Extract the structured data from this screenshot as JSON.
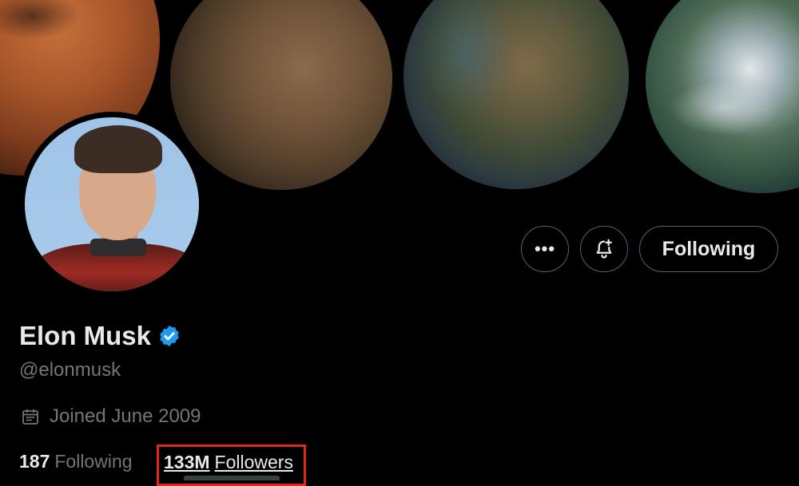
{
  "profile": {
    "name": "Elon Musk",
    "handle": "@elonmusk",
    "joined": "Joined June 2009",
    "verified_color": "#1d9bf0"
  },
  "actions": {
    "more_label": "•••",
    "following_label": "Following"
  },
  "stats": {
    "following_count": "187",
    "following_label": "Following",
    "followers_count": "133M",
    "followers_label": "Followers"
  },
  "icons": {
    "more": "more-icon",
    "notifications": "bell-plus-icon",
    "verified": "verified-badge-icon",
    "calendar": "calendar-icon"
  },
  "colors": {
    "background": "#000000",
    "text_primary": "#e7e9ea",
    "text_secondary": "#71767b",
    "border": "#536471",
    "highlight_box": "#e0291c"
  }
}
